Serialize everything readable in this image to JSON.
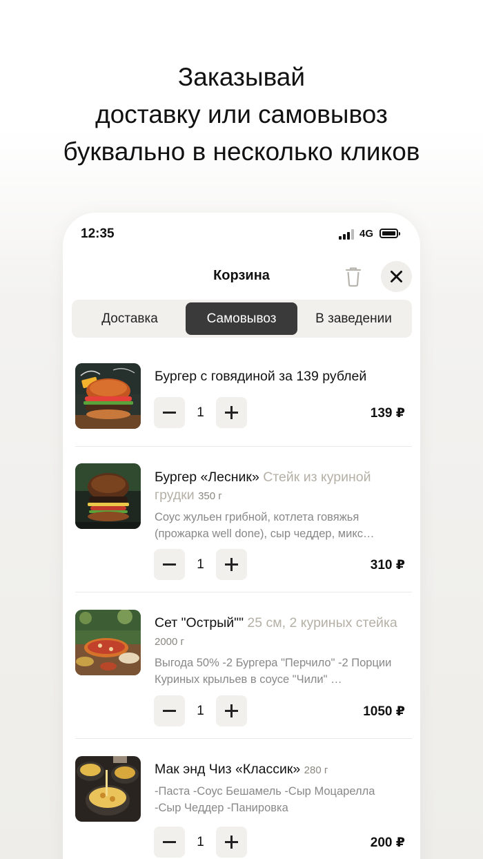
{
  "headline": {
    "line1": "Заказывай",
    "line2": "доставку или самовывоз",
    "line3": "буквально в несколько кликов"
  },
  "status_bar": {
    "time": "12:35",
    "network": "4G"
  },
  "header": {
    "title": "Корзина",
    "trash_icon": "trash-icon",
    "close_icon": "close-icon"
  },
  "tabs": [
    {
      "label": "Доставка",
      "active": false
    },
    {
      "label": "Самовывоз",
      "active": true
    },
    {
      "label": "В заведении",
      "active": false
    }
  ],
  "cart_items": [
    {
      "name": "Бургер с говядиной за 139 рублей",
      "option": "",
      "weight": "",
      "description": "",
      "quantity": "1",
      "price": "139 ₽"
    },
    {
      "name": "Бургер «Лесник» ",
      "option": "Стейк из куриной грудки",
      "weight": "350 г",
      "description": "Соус жульен грибной, котлета говяжья (прожарка well done), сыр чеддер, микс…",
      "quantity": "1",
      "price": "310 ₽"
    },
    {
      "name": "Сет \"Острый\"\" ",
      "option": "25 см, 2 куриных стейка",
      "weight": "2000 г",
      "description": "Выгода 50% -2 Бургера \"Перчило\" -2 Порции Куриных крыльев в соусе \"Чили\" …",
      "quantity": "1",
      "price": "1050 ₽"
    },
    {
      "name": "Мак энд Чиз «Классик» ",
      "option": "",
      "weight": "280 г",
      "description": "-Паста -Соус Бешамель -Сыр Моцарелла -Сыр Чеддер -Панировка",
      "quantity": "1",
      "price": "200 ₽"
    }
  ],
  "colors": {
    "accent_dark": "#3a3a3a",
    "control_bg": "#f1f0ec",
    "muted_text": "#b5b0a6"
  }
}
